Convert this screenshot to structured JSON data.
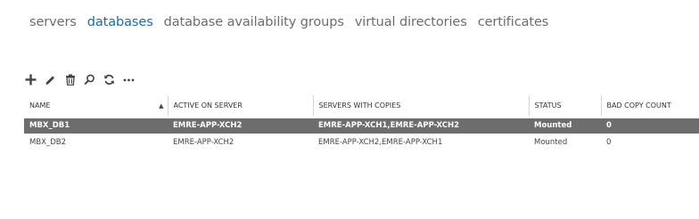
{
  "nav": {
    "tabs": [
      {
        "label": "servers",
        "active": false
      },
      {
        "label": "databases",
        "active": true
      },
      {
        "label": "database availability groups",
        "active": false
      },
      {
        "label": "virtual directories",
        "active": false
      },
      {
        "label": "certificates",
        "active": false
      }
    ]
  },
  "toolbar": {
    "buttons": [
      "plus-icon",
      "pencil-icon",
      "trash-icon",
      "search-icon",
      "refresh-icon",
      "more-icon"
    ]
  },
  "table": {
    "columns": [
      "NAME",
      "ACTIVE ON SERVER",
      "SERVERS WITH COPIES",
      "STATUS",
      "BAD COPY COUNT"
    ],
    "sort_indicator": "▲",
    "rows": [
      {
        "name": "MBX_DB1",
        "active_server": "EMRE-APP-XCH2",
        "servers_with_copies": "EMRE-APP-XCH1,EMRE-APP-XCH2",
        "status": "Mounted",
        "bad_copy_count": "0",
        "selected": true
      },
      {
        "name": "MBX_DB2",
        "active_server": "EMRE-APP-XCH2",
        "servers_with_copies": "EMRE-APP-XCH2,EMRE-APP-XCH1",
        "status": "Mounted",
        "bad_copy_count": "0",
        "selected": false
      }
    ]
  },
  "colors": {
    "accent": "#1e6ba8",
    "selected_row": "#6d6d6d",
    "tab_inactive": "#6d6d6d"
  }
}
